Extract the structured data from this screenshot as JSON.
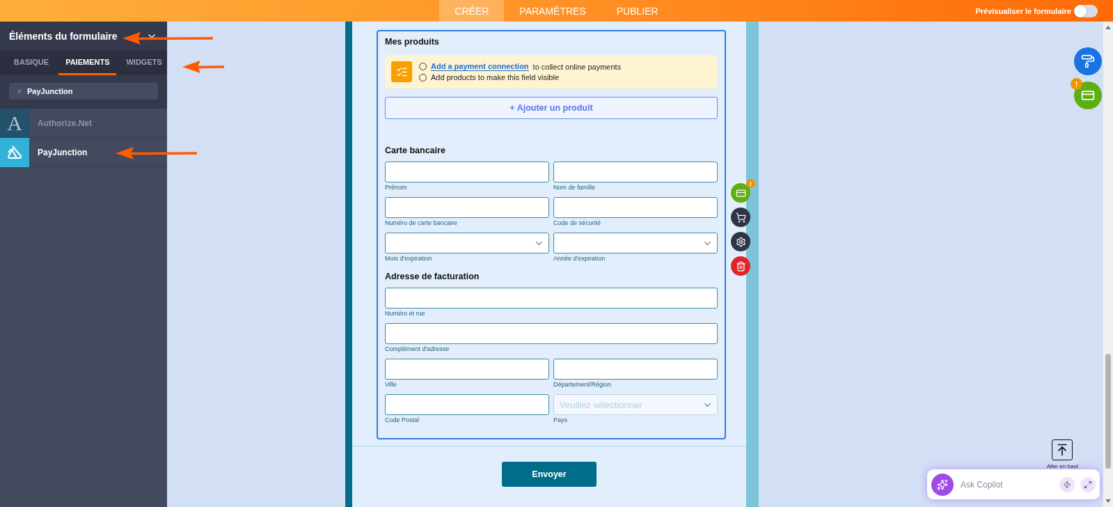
{
  "topbar": {
    "tabs": [
      {
        "label": "CRÉER",
        "selected": true
      },
      {
        "label": "PARAMÈTRES",
        "selected": false
      },
      {
        "label": "PUBLIER",
        "selected": false
      }
    ],
    "preview": {
      "label": "Prévisualiser le formulaire",
      "on": false
    }
  },
  "sidebar": {
    "title": "Éléments du formulaire",
    "tabs": [
      {
        "label": "BASIQUE",
        "selected": false
      },
      {
        "label": "PAIEMENTS",
        "selected": true
      },
      {
        "label": "WIDGETS",
        "selected": false
      }
    ],
    "search": {
      "value": "PayJunction"
    },
    "items": [
      {
        "label": "Authorize.Net",
        "logo": "A",
        "disabled": true
      },
      {
        "label": "PayJunction",
        "disabled": false
      }
    ]
  },
  "form": {
    "products": {
      "title": "Mes produits",
      "notices": [
        {
          "link": "Add a payment connection",
          "text": "to collect online payments"
        },
        {
          "text": "Add products to make this field visible"
        }
      ],
      "add_button": "+ Ajouter un produit"
    },
    "sections": [
      {
        "title": "Carte bancaire",
        "rows": [
          [
            {
              "kind": "input",
              "label": "Prénom"
            },
            {
              "kind": "input",
              "label": "Nom de famille"
            }
          ],
          [
            {
              "kind": "input",
              "label": "Numéro de carte bancaire"
            },
            {
              "kind": "input",
              "label": "Code de sécurité"
            }
          ],
          [
            {
              "kind": "select",
              "label": "Mois d'expiration"
            },
            {
              "kind": "select",
              "label": "Année d'expiration"
            }
          ]
        ]
      },
      {
        "title": "Adresse de facturation",
        "rows": [
          [
            {
              "kind": "input",
              "label": "Numéro et rue"
            }
          ],
          [
            {
              "kind": "input",
              "label": "Complément d'adresse"
            }
          ],
          [
            {
              "kind": "input",
              "label": "Ville"
            },
            {
              "kind": "input",
              "label": "Département/Région"
            }
          ],
          [
            {
              "kind": "input",
              "label": "Code Postal"
            },
            {
              "kind": "select",
              "label": "Pays",
              "placeholder": "Veuillez sélectionner"
            }
          ]
        ]
      }
    ],
    "tools": [
      {
        "kind": "card",
        "badge": "!"
      },
      {
        "kind": "cart"
      },
      {
        "kind": "settings"
      },
      {
        "kind": "delete"
      }
    ],
    "submit": "Envoyer"
  },
  "floating": [
    {
      "kind": "paint"
    },
    {
      "kind": "card",
      "badge": "!"
    }
  ],
  "scroll_top": {
    "label": "Aller en haut"
  },
  "copilot": {
    "placeholder": "Ask Copilot"
  }
}
